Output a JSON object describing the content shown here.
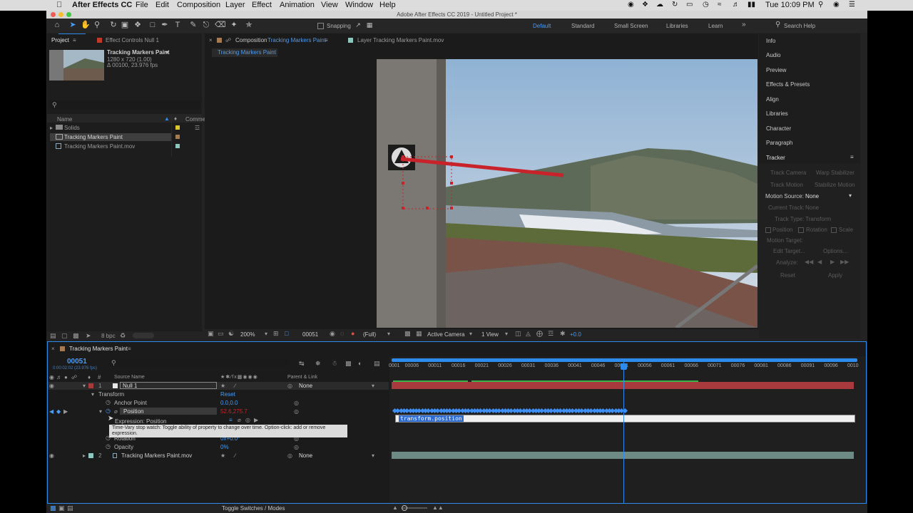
{
  "menubar": {
    "app_name": "After Effects CC",
    "items": [
      "File",
      "Edit",
      "Composition",
      "Layer",
      "Effect",
      "Animation",
      "View",
      "Window",
      "Help"
    ],
    "clock": "Tue 10:09 PM",
    "battery_icon": "battery-icon",
    "wifi_icon": "wifi-icon"
  },
  "window": {
    "title": "Adobe After Effects CC 2019 - Untitled Project *"
  },
  "toolbar": {
    "snapping_label": "Snapping",
    "workspaces": [
      "Default",
      "Standard",
      "Small Screen",
      "Libraries",
      "Learn"
    ],
    "active_workspace": "Default",
    "search_placeholder": "Search Help"
  },
  "project_panel": {
    "tab_project": "Project",
    "tab_effect_controls": "Effect Controls Null 1",
    "selected_name": "Tracking Markers Paint",
    "selected_dims": "1280 x 720 (1.00)",
    "selected_duration": "Δ 00100, 23.976 fps",
    "col_name": "Name",
    "col_comment": "Comme",
    "items": [
      {
        "name": "Solids",
        "type": "folder",
        "color": "#d9c832"
      },
      {
        "name": "Tracking Markers Paint",
        "type": "comp",
        "color": "#a67b53"
      },
      {
        "name": "Tracking Markers Paint.mov",
        "type": "footage",
        "color": "#8ec7bd"
      }
    ],
    "bpc": "8 bpc"
  },
  "comp_panel": {
    "tab_label_prefix": "Composition",
    "tab_comp_name": "Tracking Markers Paint",
    "layer_tab": "Layer Tracking Markers Paint.mov",
    "breadcrumb": "Tracking Markers Paint",
    "zoom": "200%",
    "frame": "00051",
    "resolution": "(Full)",
    "camera": "Active Camera",
    "view": "1 View",
    "exposure": "+0.0"
  },
  "right_panel": {
    "items": [
      "Info",
      "Audio",
      "Preview",
      "Effects & Presets",
      "Align",
      "Libraries",
      "Character",
      "Paragraph"
    ],
    "tracker_title": "Tracker",
    "track_camera": "Track Camera",
    "warp_stabilizer": "Warp Stabilizer",
    "track_motion": "Track Motion",
    "stabilize_motion": "Stabilize Motion",
    "motion_source_label": "Motion Source:",
    "motion_source_value": "None",
    "current_track_label": "Current Track:",
    "current_track_value": "None",
    "track_type_label": "Track Type:",
    "track_type_value": "Transform",
    "position_cb": "Position",
    "rotation_cb": "Rotation",
    "scale_cb": "Scale",
    "motion_target": "Motion Target:",
    "edit_target": "Edit Target...",
    "options": "Options...",
    "analyze": "Analyze:",
    "reset": "Reset",
    "apply": "Apply"
  },
  "timeline": {
    "tab": "Tracking Markers Paint",
    "timecode": "00051",
    "timecode_sub": "0:00:02:02 (23.976 fps)",
    "col_source": "Source Name",
    "col_parent": "Parent & Link",
    "layer1_num": "1",
    "layer1_name": "Null 1",
    "layer1_parent": "None",
    "transform": "Transform",
    "transform_reset": "Reset",
    "anchor_point": "Anchor Point",
    "anchor_value": "0.0,0.0",
    "position": "Position",
    "position_value": "52.6,275.7",
    "expression_label": "Expression: Position",
    "rotation": "Rotation",
    "rotation_value": "0x+0.0°",
    "opacity": "Opacity",
    "opacity_value": "0%",
    "layer2_num": "2",
    "layer2_name": "Tracking Markers Paint.mov",
    "layer2_parent": "None",
    "tooltip": "Time-Vary stop watch: Toggle ability of property to change over time. Option-click: add or remove expression.",
    "expression_text": "transform.position",
    "ruler_ticks": [
      "0001",
      "00006",
      "00011",
      "00016",
      "00021",
      "00026",
      "00031",
      "00036",
      "00041",
      "00046",
      "00051",
      "00056",
      "00061",
      "00066",
      "00071",
      "00076",
      "00081",
      "00086",
      "00091",
      "00096",
      "0010"
    ],
    "toggle_label": "Toggle Switches / Modes"
  },
  "colors": {
    "accent": "#2d8ceb",
    "layer1_bar": "#a83a3d",
    "layer2_bar": "#6d8a84",
    "track_line": "#c8232a"
  }
}
